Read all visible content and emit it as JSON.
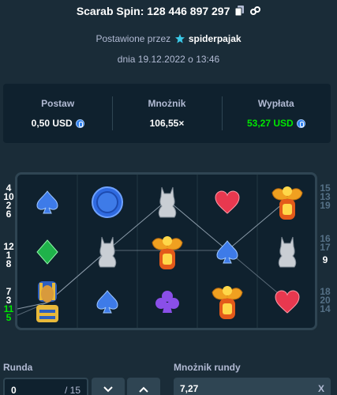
{
  "header": {
    "title": "Scarab Spin: 128 446 897 297",
    "copy_icon": "copy-icon",
    "link_icon": "link-icon"
  },
  "meta": {
    "placed_by_prefix": "Postawione przez",
    "username": "spiderpajak",
    "date": "dnia 19.12.2022 o 13:46"
  },
  "stats": [
    {
      "label": "Postaw",
      "value": "0,50 USD",
      "currency_icon": "usdc-coin-icon"
    },
    {
      "label": "Mnożnik",
      "value": "106,55×"
    },
    {
      "label": "Wypłata",
      "value": "53,27 USD",
      "currency_icon": "usdc-coin-icon",
      "color": "#00e701"
    }
  ],
  "reels": [
    [
      "spade-blue",
      "diamond-green",
      "pharaoh"
    ],
    [
      "blue-coin",
      "cat-statue",
      "spade-blue"
    ],
    [
      "cat-statue",
      "scarab",
      "club-purple"
    ],
    [
      "heart-red",
      "spade-blue",
      "scarab"
    ],
    [
      "scarab",
      "cat-statue",
      "heart-red"
    ]
  ],
  "paylines_left": [
    [
      "4",
      "10",
      "2",
      "6"
    ],
    [
      "12",
      "1",
      "8"
    ],
    [
      "7",
      "3",
      "11",
      "5"
    ]
  ],
  "paylines_right": [
    [
      "15",
      "13",
      "19"
    ],
    [
      "16",
      "17",
      "9"
    ],
    [
      "18",
      "20",
      "14"
    ]
  ],
  "controls": {
    "round_label": "Runda",
    "round_value": "0",
    "round_total": "/ 15",
    "round_multiplier_label": "Mnożnik rundy",
    "round_multiplier_value": "7,27",
    "multiplier_suffix": "X"
  },
  "colors": {
    "background": "#1a2c38",
    "panel": "#0f212e",
    "border": "#2f4553",
    "win_green": "#00e701",
    "muted_text": "#b1bad3"
  }
}
